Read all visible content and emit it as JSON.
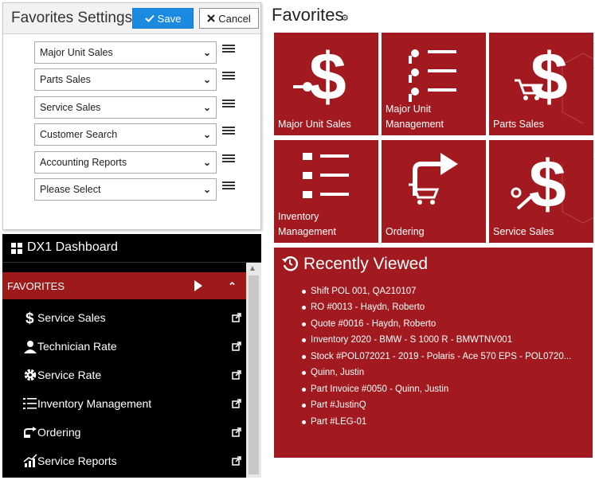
{
  "settings": {
    "title": "Favorites Settings",
    "save_label": "Save",
    "cancel_label": "Cancel",
    "favorites": [
      {
        "value": "Major Unit Sales"
      },
      {
        "value": "Parts Sales"
      },
      {
        "value": "Service Sales"
      },
      {
        "value": "Customer Search"
      },
      {
        "value": "Accounting Reports"
      },
      {
        "value": "Please Select"
      }
    ]
  },
  "dashboard": {
    "title": "DX1 Dashboard",
    "favorites_label": "FAVORITES",
    "items": [
      {
        "label": "Service Sales",
        "icon": "dollar-icon"
      },
      {
        "label": "Technician Rate",
        "icon": "technician-icon"
      },
      {
        "label": "Service Rate",
        "icon": "gear-icon"
      },
      {
        "label": "Inventory Management",
        "icon": "list-icon"
      },
      {
        "label": "Ordering",
        "icon": "ordering-icon"
      },
      {
        "label": "Service Reports",
        "icon": "chart-icon"
      }
    ]
  },
  "favorites": {
    "title": "Favorites",
    "tiles": [
      {
        "label": "Major Unit Sales",
        "icon": "dollar-keys-icon"
      },
      {
        "label": "Major Unit Management",
        "icon": "keys-list-icon"
      },
      {
        "label": "Parts Sales",
        "icon": "dollar-cart-icon"
      },
      {
        "label": "Inventory Management",
        "icon": "cart-list-icon"
      },
      {
        "label": "Ordering",
        "icon": "cart-arrow-icon"
      },
      {
        "label": "Service Sales",
        "icon": "dollar-wrench-icon"
      }
    ]
  },
  "recent": {
    "title": "Recently Viewed",
    "items": [
      "Shift POL 001, QA210107",
      "RO #0013 - Haydn, Roberto",
      "Quote #0016 - Haydn, Roberto",
      "Inventory 2020 - BMW - S 1000 R - BMWTNV001",
      "Stock #POL072021 - 2019 - Polaris - Ace 570 EPS - POL0720...",
      "Quinn, Justin",
      "Part Invoice #0050 - Quinn, Justin",
      "Part #JustinQ",
      "Part #LEG-01"
    ]
  },
  "colors": {
    "tile_red": "#a21a1f",
    "save_blue": "#1a8be0",
    "sidebar_bg": "#000000",
    "favorites_bar": "#9e1a1a"
  }
}
